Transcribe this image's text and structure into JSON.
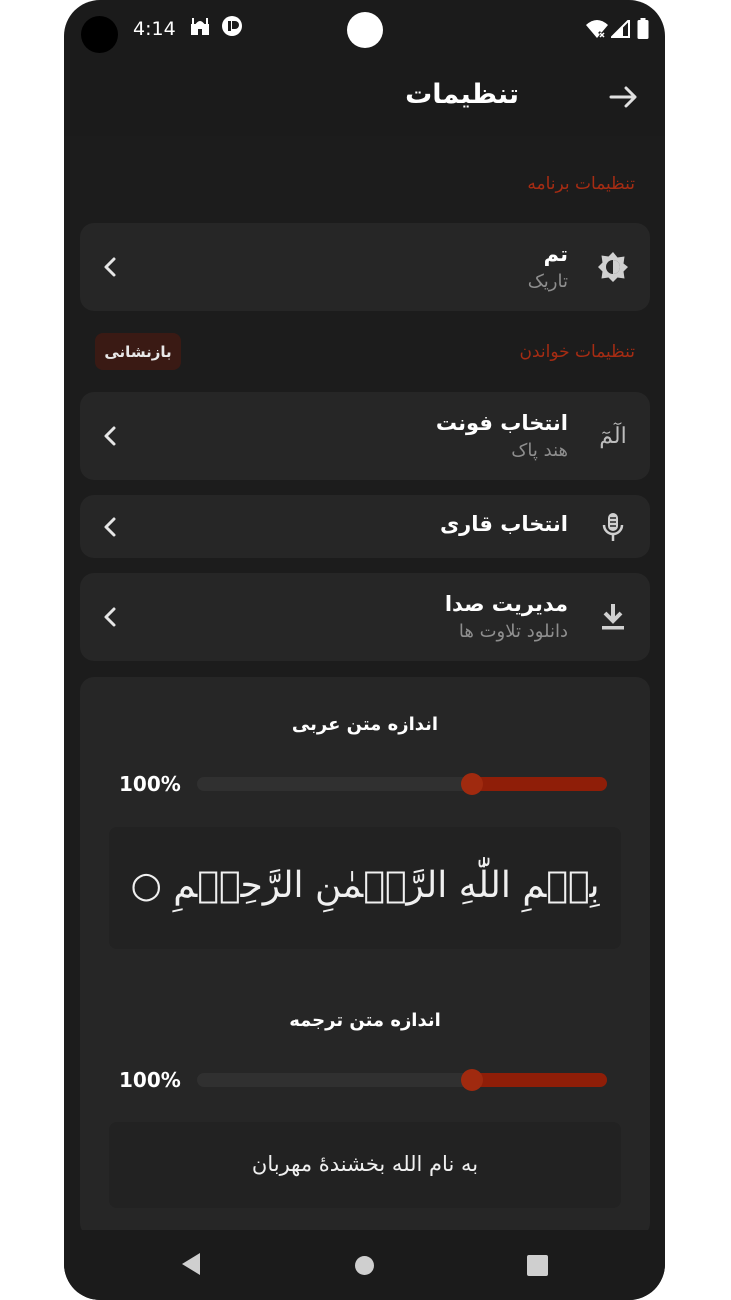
{
  "status_bar": {
    "time": "4:14",
    "left_icons": [
      "mosque-icon",
      "font-badge-icon"
    ],
    "right_icons": [
      "wifi-icon",
      "signal-icon",
      "battery-icon"
    ]
  },
  "app_bar": {
    "title": "تنظیمات",
    "back_icon": "arrow-right-icon"
  },
  "sections": {
    "app_settings": "تنظیمات برنامه",
    "reading_settings": "تنظیمات خواندن",
    "reset_label": "بازنشانی"
  },
  "items": {
    "theme": {
      "title": "تم",
      "subtitle": "تاریک",
      "icon": "brightness-icon"
    },
    "font": {
      "title": "انتخاب فونت",
      "subtitle": "هند پاک",
      "icon": "alm-icon",
      "icon_text": "الٓمٓ"
    },
    "reciter": {
      "title": "انتخاب قاری",
      "icon": "microphone-icon"
    },
    "audio": {
      "title": "مدیریت صدا",
      "subtitle": "دانلود تلاوت ها",
      "icon": "download-icon"
    }
  },
  "arabic_size": {
    "label": "اندازه متن عربی",
    "percent_text": "100%",
    "slider_fraction": 0.33,
    "preview": "بِسۡمِ اللّٰهِ الرَّحۡمٰنِ الرَّحِيۡمِ ○"
  },
  "translation_size": {
    "label": "اندازه متن ترجمه",
    "percent_text": "100%",
    "slider_fraction": 0.33,
    "preview": "به نام الله بخشندۀ مهربان"
  },
  "colors": {
    "accent": "#a62c13",
    "background": "#1c1c1c",
    "card": "#262626"
  }
}
